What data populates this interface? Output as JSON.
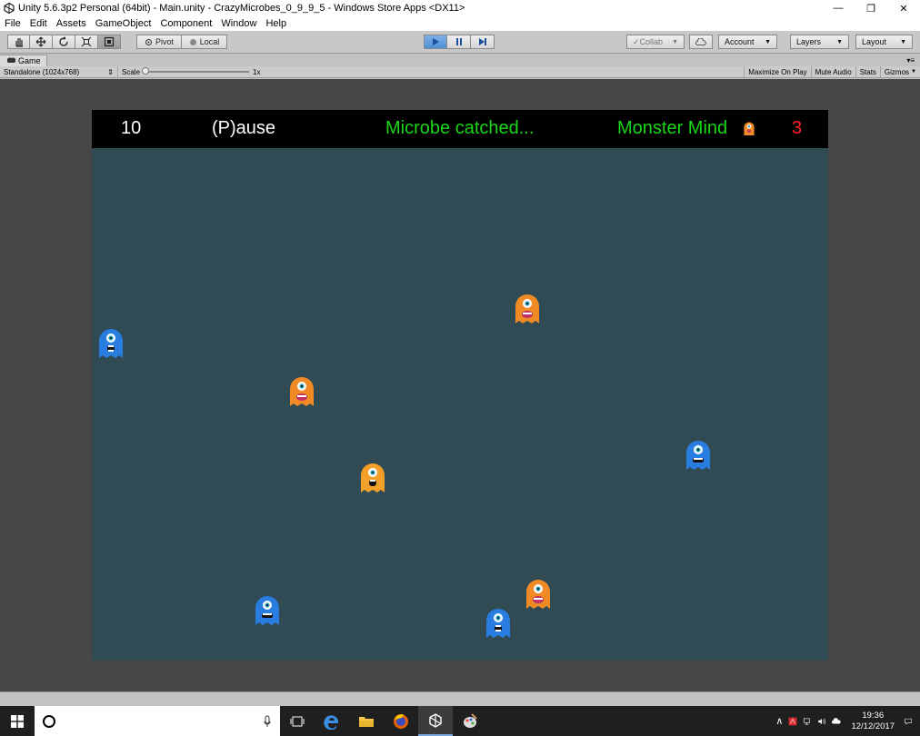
{
  "window": {
    "title": "Unity 5.6.3p2 Personal (64bit) - Main.unity - CrazyMicrobes_0_9_9_5 - Windows Store Apps <DX11>",
    "controls": [
      "—",
      "❐",
      "✕"
    ]
  },
  "menu": [
    "File",
    "Edit",
    "Assets",
    "GameObject",
    "Component",
    "Window",
    "Help"
  ],
  "toolbar": {
    "pivot": "Pivot",
    "local": "Local",
    "collab": "Collab",
    "account": "Account",
    "layers": "Layers",
    "layout": "Layout"
  },
  "game_tab": {
    "label": "Game",
    "display": "Standalone (1024x768)",
    "scale_label": "Scale",
    "scale_value": "1x",
    "buttons": [
      "Maximize On Play",
      "Mute Audio",
      "Stats",
      "Gizmos"
    ]
  },
  "hud": {
    "score": "10",
    "pause": "(P)ause",
    "status": "Microbe catched...",
    "mode": "Monster Mind",
    "lives": "3"
  },
  "taskbar": {
    "time": "19:36",
    "date": "12/12/2017"
  },
  "colors": {
    "hud_green": "#19d619",
    "hud_red": "#ff2020",
    "playfield": "#314b54",
    "microbe_orange": "#f08a24",
    "microbe_blue": "#2a7de0"
  }
}
